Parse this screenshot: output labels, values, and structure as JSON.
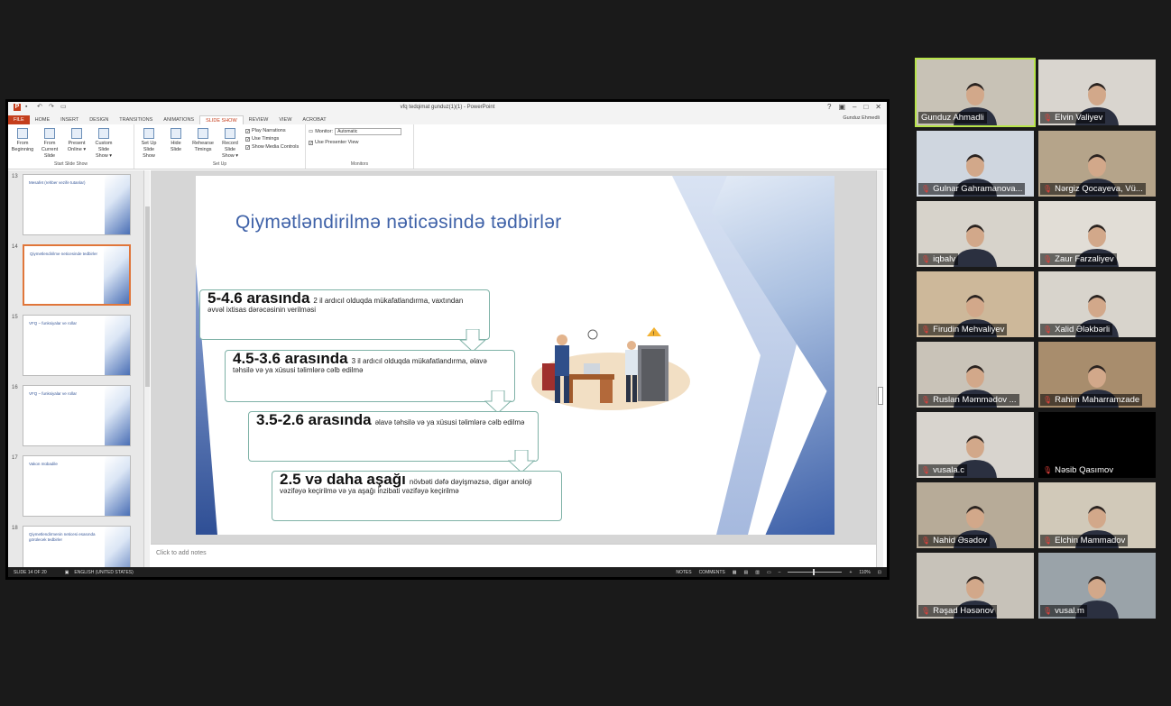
{
  "ppt": {
    "window_title": "vfq tedqimat gunduz(1)(1) - PowerPoint",
    "user": "Gunduz Ehmedli",
    "tabs": [
      "FILE",
      "HOME",
      "INSERT",
      "DESIGN",
      "TRANSITIONS",
      "ANIMATIONS",
      "SLIDE SHOW",
      "REVIEW",
      "VIEW",
      "ACROBAT"
    ],
    "active_tab": "SLIDE SHOW",
    "ribbon": {
      "start": {
        "name": "Start Slide Show",
        "buttons": [
          {
            "l1": "From",
            "l2": "Beginning"
          },
          {
            "l1": "From",
            "l2": "Current Slide"
          },
          {
            "l1": "Present",
            "l2": "Online ▾"
          },
          {
            "l1": "Custom Slide",
            "l2": "Show ▾"
          }
        ]
      },
      "setup": {
        "name": "Set Up",
        "buttons": [
          {
            "l1": "Set Up",
            "l2": "Slide Show"
          },
          {
            "l1": "Hide",
            "l2": "Slide"
          },
          {
            "l1": "Rehearse",
            "l2": "Timings"
          },
          {
            "l1": "Record Slide",
            "l2": "Show ▾"
          }
        ],
        "checks": [
          "Play Narrations",
          "Use Timings",
          "Show Media Controls"
        ]
      },
      "monitors": {
        "name": "Monitors",
        "monitor_label": "Monitor:",
        "monitor_value": "Automatic",
        "presenter": "Use Presenter View"
      }
    },
    "thumbs": [
      {
        "num": "13",
        "text": "Mesafet (rehber vezife tutanlar)"
      },
      {
        "num": "14",
        "text": "Qiymetlendirilme neticesinde tedbirler"
      },
      {
        "num": "15",
        "text": "VFQ – funksiyalar ve rollar"
      },
      {
        "num": "16",
        "text": "VFQ – funksiyalar ve rollar"
      },
      {
        "num": "17",
        "text": "Vakon mübadile"
      },
      {
        "num": "18",
        "text": "Qiymetlendirmenin neticesi esasında görülecek tedbirler"
      }
    ],
    "slide": {
      "title": "Qiymətləndirilmə nəticəsində tədbirlər",
      "steps": [
        {
          "big": "5-4.6 arasında",
          "text": "2 il ardıcıl olduqda mükafatlandırma, vaxtından əvvəl ixtisas dərəcəsinin verilməsi"
        },
        {
          "big": "4.5-3.6 arasında",
          "text": "3 il ardıcıl olduqda mükafatlandırma, əlavə təhsilə və ya xüsusi təlimlərə cəlb edilmə"
        },
        {
          "big": "3.5-2.6 arasında",
          "text": "əlavə təhsilə və ya xüsusi təlimlərə cəlb edilmə"
        },
        {
          "big": "2.5 və daha aşağı",
          "text": "növbəti dəfə dəyişməzsə, digər anoloji vəzifəyə keçirilmə və ya aşağı inzibati vəzifəyə keçirilmə"
        }
      ]
    },
    "notes_placeholder": "Click to add notes",
    "status": {
      "slide": "SLIDE 14 OF 20",
      "lang": "ENGLISH (UNITED STATES)",
      "notes": "NOTES",
      "comments": "COMMENTS",
      "zoom": "110%"
    }
  },
  "participants": [
    "Gunduz Ahmadli",
    "Elvin Valiyev",
    "Gulnar Gahramanova...",
    "Nərgiz Qocayeva, Vü...",
    "iqbalv",
    "Zaur Farzaliyev",
    "Firudin Mehvaliyev",
    "Xalid Ələkbərli",
    "Ruslan Məmmədov ...",
    "Rahim Maharramzade",
    "vusala.c",
    "Nəsib Qasımov",
    "Nahid Əsədov",
    "Elchin Mammadov",
    "Rəşad Həsənov",
    "vusal.m"
  ]
}
